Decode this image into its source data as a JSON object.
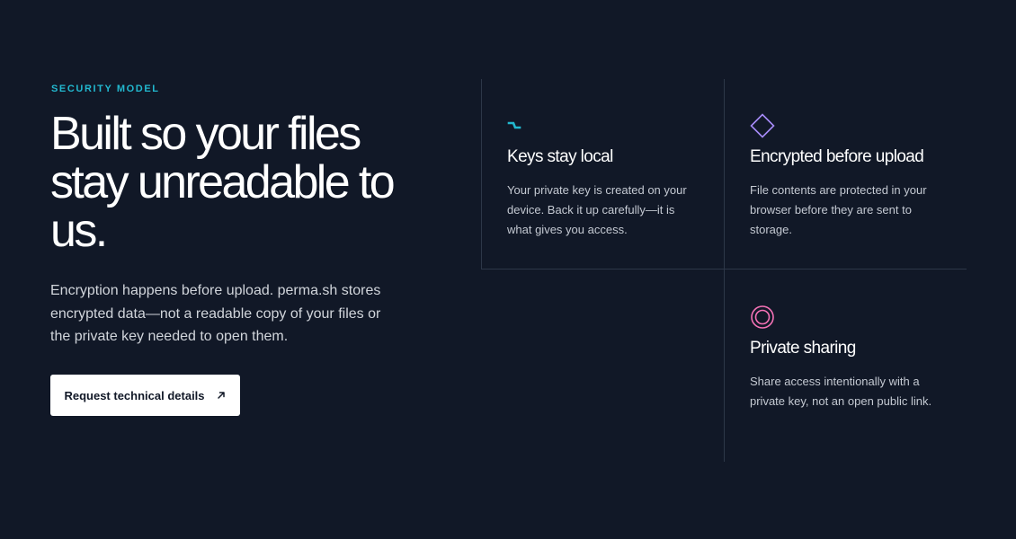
{
  "section": {
    "eyebrow": "SECURITY MODEL",
    "headline": "Built so your files stay unreadable to us.",
    "lede": "Encryption happens before upload. perma.sh stores encrypted data—not a readable copy of your files or the private key needed to open them.",
    "cta": {
      "label": "Request technical details",
      "icon": "arrow-up-right-icon"
    }
  },
  "features": [
    {
      "title": "Keys stay local",
      "description": "Your private key is created on your device. Back it up carefully—it is what gives you access.",
      "icon": "zigzag-icon",
      "icon_color": "#22b8cf"
    },
    {
      "title": "Encrypted before upload",
      "description": "File contents are protected in your browser before they are sent to storage.",
      "icon": "diamond-icon",
      "icon_color": "#a78bfa"
    },
    {
      "title": "Private sharing",
      "description": "Share access intentionally with a private key, not an open public link.",
      "icon": "concentric-circles-icon",
      "icon_color": "#f472b6"
    }
  ],
  "colors": {
    "background": "#111827",
    "accent_teal": "#22b8cf",
    "accent_violet": "#a78bfa",
    "accent_pink": "#f472b6",
    "divider": "#2d3748"
  }
}
